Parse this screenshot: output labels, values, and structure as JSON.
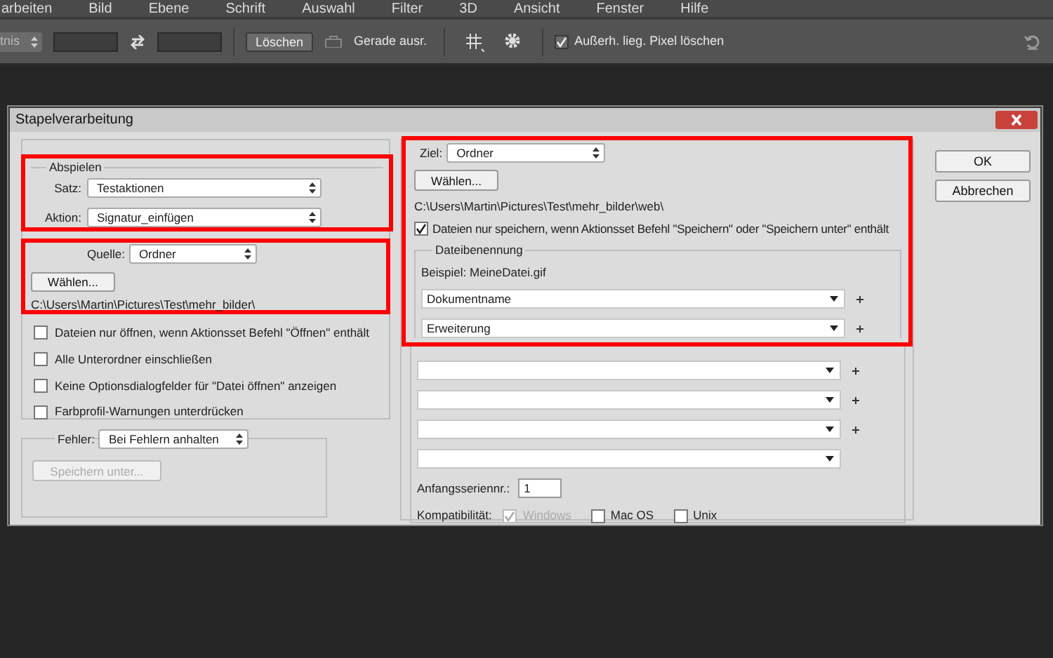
{
  "menu_bar": [
    "arbeiten",
    "Bild",
    "Ebene",
    "Schrift",
    "Auswahl",
    "Filter",
    "3D",
    "Ansicht",
    "Fenster",
    "Hilfe"
  ],
  "options_bar": {
    "ratio": "tnis",
    "clear_button": "Löschen",
    "straighten_label": "Gerade ausr.",
    "delete_pixels": {
      "label": "Außerh. lieg. Pixel löschen",
      "checked": true
    }
  },
  "dialog": {
    "title": "Stapelverarbeitung",
    "play": {
      "legend": "Abspielen",
      "fields": [
        {
          "label": "Satz:",
          "value": "Testaktionen"
        },
        {
          "label": "Aktion:",
          "value": "Signatur_einfügen"
        }
      ]
    },
    "source": {
      "label": "Quelle:",
      "value": "Ordner",
      "button": "Wählen...",
      "path": "C:\\Users\\Martin\\Pictures\\Test\\mehr_bilder\\"
    },
    "source_options": [
      {
        "label": "Dateien nur öffnen, wenn Aktionsset Befehl \"Öffnen\" enthält",
        "checked": false
      },
      {
        "label": "Alle Unterordner einschließen",
        "checked": false
      },
      {
        "label": "Keine Optionsdialogfelder für \"Datei öffnen\" anzeigen",
        "checked": false
      },
      {
        "label": "Farbprofil-Warnungen unterdrücken",
        "checked": false
      }
    ],
    "errors": {
      "label": "Fehler:",
      "value": "Bei Fehlern anhalten",
      "button": {
        "label": "Speichern unter...",
        "disabled": true
      }
    },
    "destination": {
      "label": "Ziel:",
      "value": "Ordner",
      "button": "Wählen...",
      "path": "C:\\Users\\Martin\\Pictures\\Test\\mehr_bilder\\web\\",
      "save_only": {
        "label": "Dateien nur speichern, wenn Aktionsset Befehl \"Speichern\" oder \"Speichern unter\" enthält",
        "checked": true
      }
    },
    "naming": {
      "legend": "Dateibenennung",
      "example": "Beispiel: MeineDatei.gif",
      "parts": [
        {
          "value": "Dokumentname",
          "plus": true
        },
        {
          "value": "Erweiterung",
          "plus": true
        },
        {
          "plus": true
        },
        {
          "plus": true
        },
        {
          "plus": true
        },
        {
          "plus": false
        }
      ],
      "serial_label": "Anfangsseriennr.:",
      "serial_value": "1",
      "compat_label": "Kompatibilität:",
      "compat": [
        {
          "label": "Windows",
          "checked": true,
          "disabled": true
        },
        {
          "label": "Mac OS",
          "checked": false,
          "disabled": false
        },
        {
          "label": "Unix",
          "checked": false,
          "disabled": false
        }
      ]
    },
    "buttons": [
      "OK",
      "Abbrechen"
    ]
  }
}
